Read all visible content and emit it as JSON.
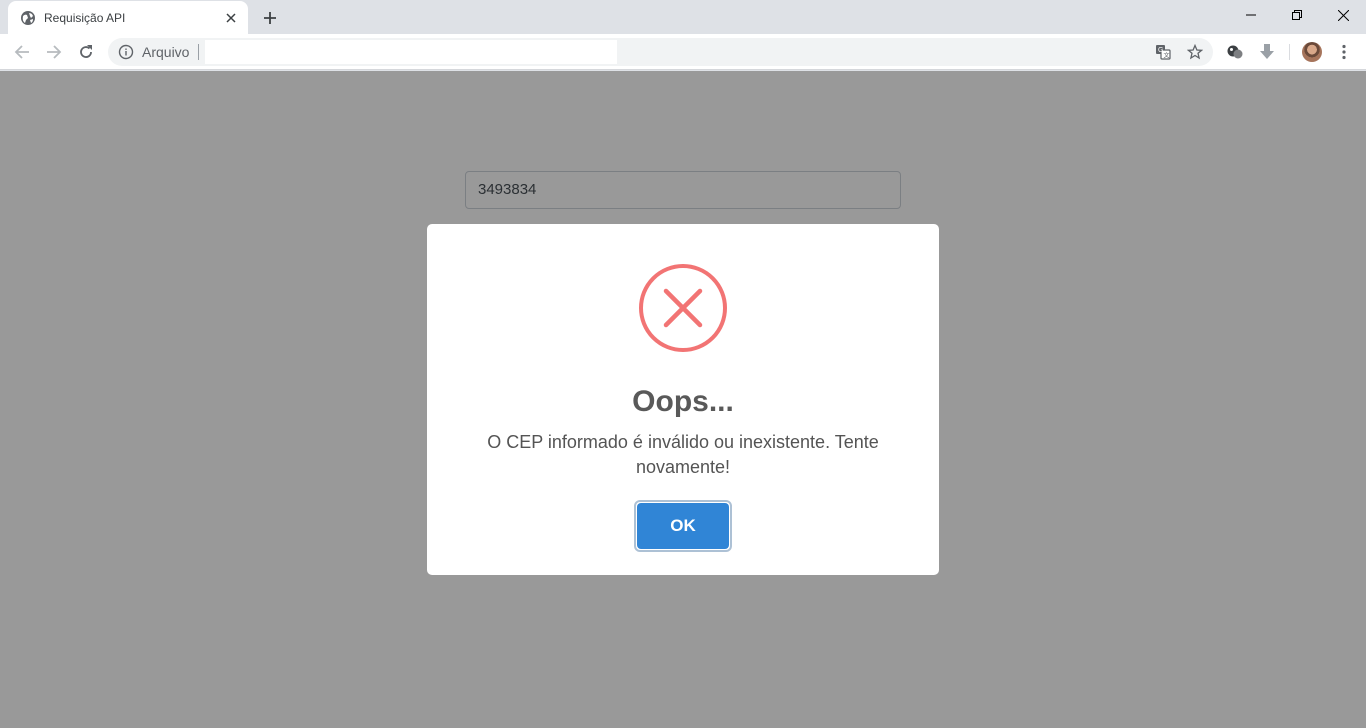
{
  "browser": {
    "tab": {
      "title": "Requisição API",
      "favicon": "globe-icon",
      "close_icon": "close-icon"
    },
    "new_tab_icon": "plus-icon",
    "window_controls": [
      "minimize-icon",
      "restore-icon",
      "close-icon"
    ],
    "nav": [
      "back-arrow-icon",
      "forward-arrow-icon",
      "reload-icon"
    ],
    "omnibox": {
      "info_icon": "info-icon",
      "chip_label": "Arquivo",
      "url": ""
    },
    "omnibox_actions": [
      "translate-icon",
      "star-icon"
    ],
    "extensions": [
      "extension-icon",
      "download-arrow-icon"
    ],
    "menu_icon": "three-dots-menu-icon"
  },
  "page": {
    "cep_field": {
      "value": "3493834"
    }
  },
  "alert": {
    "icon": "error-x-icon",
    "title": "Oops...",
    "message": "O CEP informado é inválido ou inexistente. Tente novamente!",
    "confirm_label": "OK",
    "icon_color": "#f27474",
    "button_color": "#3085d6"
  }
}
